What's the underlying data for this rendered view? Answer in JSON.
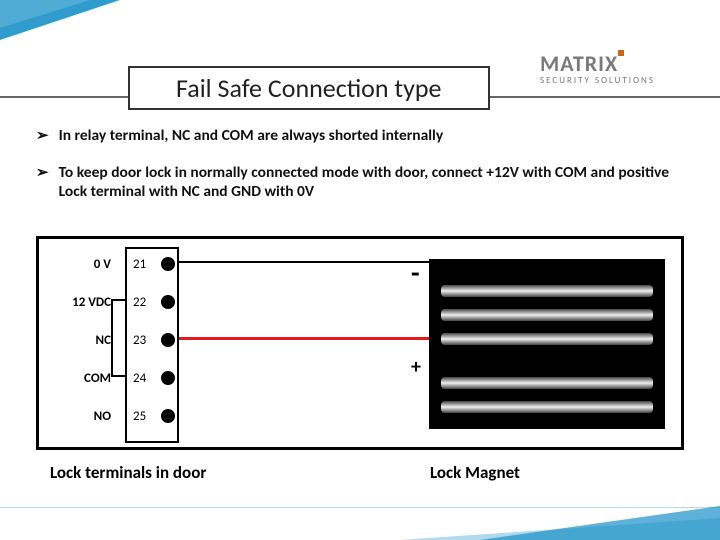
{
  "logo": {
    "brand": "MATRIX",
    "tagline": "SECURITY SOLUTIONS"
  },
  "title": "Fail Safe Connection type",
  "bullets": [
    "In relay terminal, NC and COM are always shorted internally",
    "To keep door lock in normally connected mode with door, connect +12V with COM and positive Lock terminal with NC and GND with 0V"
  ],
  "terminals": [
    {
      "label": "0 V",
      "pin": "21"
    },
    {
      "label": "12 VDC",
      "pin": "22"
    },
    {
      "label": "NC",
      "pin": "23"
    },
    {
      "label": "COM",
      "pin": "24"
    },
    {
      "label": "NO",
      "pin": "25"
    }
  ],
  "polarity": {
    "negative": "-",
    "positive": "+"
  },
  "captions": {
    "left": "Lock terminals in door",
    "right": "Lock Magnet"
  }
}
